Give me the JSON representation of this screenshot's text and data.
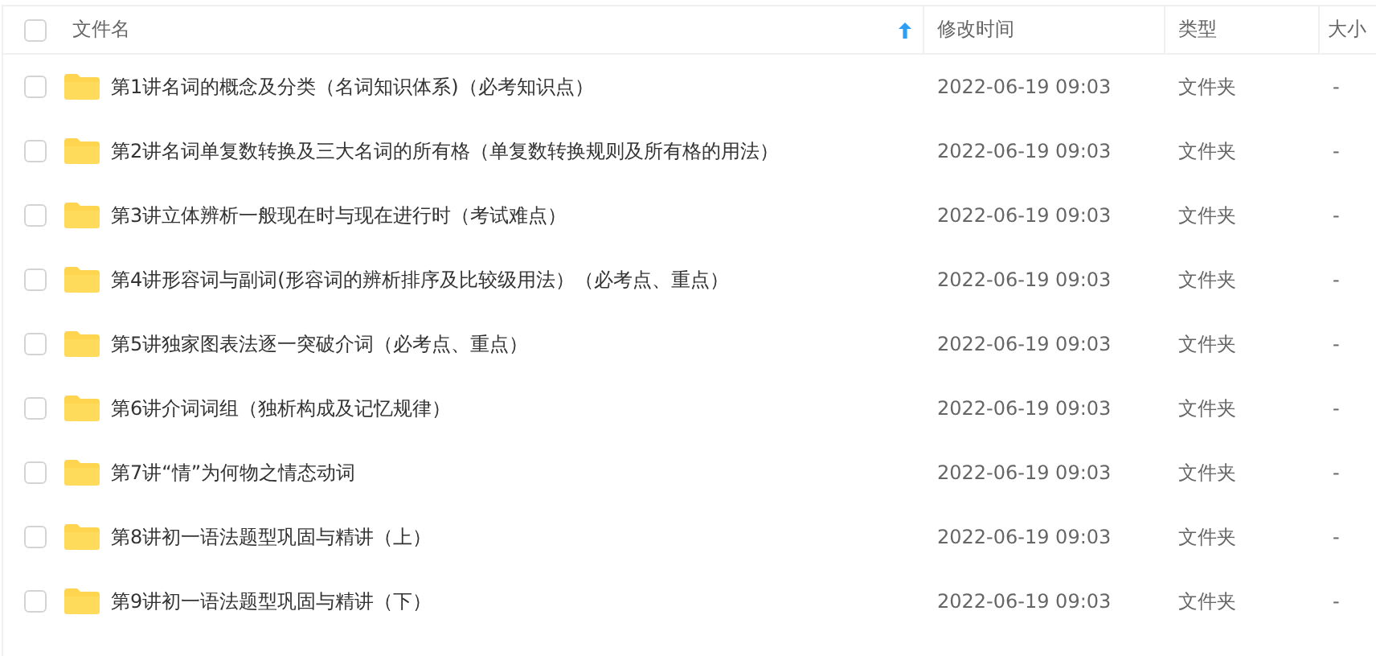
{
  "table": {
    "header_checkbox": {
      "checked": false
    },
    "columns": [
      {
        "label": "文件名",
        "sorted": true
      },
      {
        "label": "修改时间",
        "sorted": false
      },
      {
        "label": "类型",
        "sorted": false
      },
      {
        "label": "大小",
        "sorted": false
      }
    ],
    "rows": [
      {
        "checked": false,
        "name": "第1讲名词的概念及分类（名词知识体系)（必考知识点）",
        "modified": "2022-06-19 09:03",
        "type": "文件夹",
        "size": "-"
      },
      {
        "checked": false,
        "name": "第2讲名词单复数转换及三大名词的所有格（单复数转换规则及所有格的用法）",
        "modified": "2022-06-19 09:03",
        "type": "文件夹",
        "size": "-"
      },
      {
        "checked": false,
        "name": "第3讲立体辨析一般现在时与现在进行时（考试难点）",
        "modified": "2022-06-19 09:03",
        "type": "文件夹",
        "size": "-"
      },
      {
        "checked": false,
        "name": "第4讲形容词与副词(形容词的辨析排序及比较级用法）（必考点、重点）",
        "modified": "2022-06-19 09:03",
        "type": "文件夹",
        "size": "-"
      },
      {
        "checked": false,
        "name": "第5讲独家图表法逐一突破介词（必考点、重点）",
        "modified": "2022-06-19 09:03",
        "type": "文件夹",
        "size": "-"
      },
      {
        "checked": false,
        "name": "第6讲介词词组（独析构成及记忆规律）",
        "modified": "2022-06-19 09:03",
        "type": "文件夹",
        "size": "-"
      },
      {
        "checked": false,
        "name": "第7讲“情”为何物之情态动词",
        "modified": "2022-06-19 09:03",
        "type": "文件夹",
        "size": "-"
      },
      {
        "checked": false,
        "name": "第8讲初一语法题型巩固与精讲（上）",
        "modified": "2022-06-19 09:03",
        "type": "文件夹",
        "size": "-"
      },
      {
        "checked": false,
        "name": "第9讲初一语法题型巩固与精讲（下）",
        "modified": "2022-06-19 09:03",
        "type": "文件夹",
        "size": "-"
      }
    ]
  }
}
